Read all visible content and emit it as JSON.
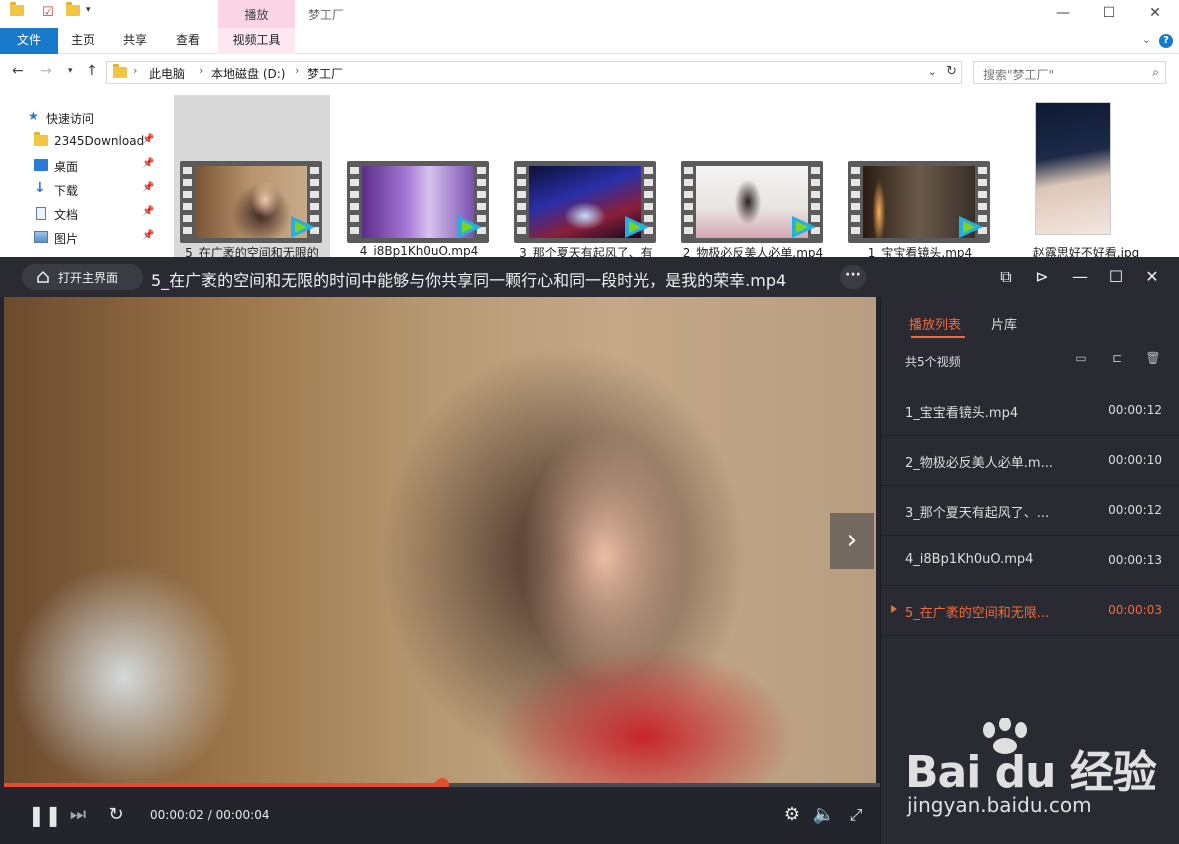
{
  "explorer": {
    "window_title": "梦工厂",
    "contextual_tab": "播放",
    "ribbon_tabs": [
      "文件",
      "主页",
      "共享",
      "查看",
      "视频工具"
    ],
    "address": {
      "crumbs": [
        "此电脑",
        "本地磁盘 (D:)",
        "梦工厂"
      ]
    },
    "search": {
      "placeholder": "搜索\"梦工厂\""
    },
    "nav": {
      "quick_access": "快速访问",
      "items": [
        "2345Download",
        "桌面",
        "下载",
        "文档",
        "图片"
      ]
    },
    "files": [
      {
        "name": "5_在广袤的空间和无限的",
        "type": "video",
        "selected": true
      },
      {
        "name": "4_i8Bp1Kh0uO.mp4",
        "type": "video",
        "selected": false
      },
      {
        "name": "3_那个夏天有起风了、有",
        "type": "video",
        "selected": false
      },
      {
        "name": "2_物极必反美人必单.mp4",
        "type": "video",
        "selected": false
      },
      {
        "name": "1_宝宝看镜头.mp4",
        "type": "video",
        "selected": false
      },
      {
        "name": "赵露思好不好看.jpg",
        "type": "image",
        "selected": false
      }
    ]
  },
  "player": {
    "home_button": "打开主界面",
    "title": "5_在广袤的空间和无限的时间中能够与你共享同一颗行心和同一段时光，是我的荣幸.mp4",
    "time_current": "00:00:02",
    "time_total": "00:00:04",
    "time_display": "00:00:02 / 00:00:04",
    "progress": 0.5,
    "playlist": {
      "tab_playlist": "播放列表",
      "tab_library": "片库",
      "count_label": "共5个视频",
      "items": [
        {
          "name": "1_宝宝看镜头.mp4",
          "duration": "00:00:12",
          "current": false
        },
        {
          "name": "2_物极必反美人必单.m...",
          "duration": "00:00:10",
          "current": false
        },
        {
          "name": "3_那个夏天有起风了、...",
          "duration": "00:00:12",
          "current": false
        },
        {
          "name": "4_i8Bp1Kh0uO.mp4",
          "duration": "00:00:13",
          "current": false
        },
        {
          "name": "5_在广袤的空间和无限...",
          "duration": "00:00:03",
          "current": true
        }
      ]
    }
  },
  "watermark": {
    "brand": "Bai du 经验",
    "url": "jingyan.baidu.com"
  },
  "colors": {
    "accent": "#f06a3c",
    "explorer_blue": "#1979ca",
    "player_bg": "#24252c"
  }
}
